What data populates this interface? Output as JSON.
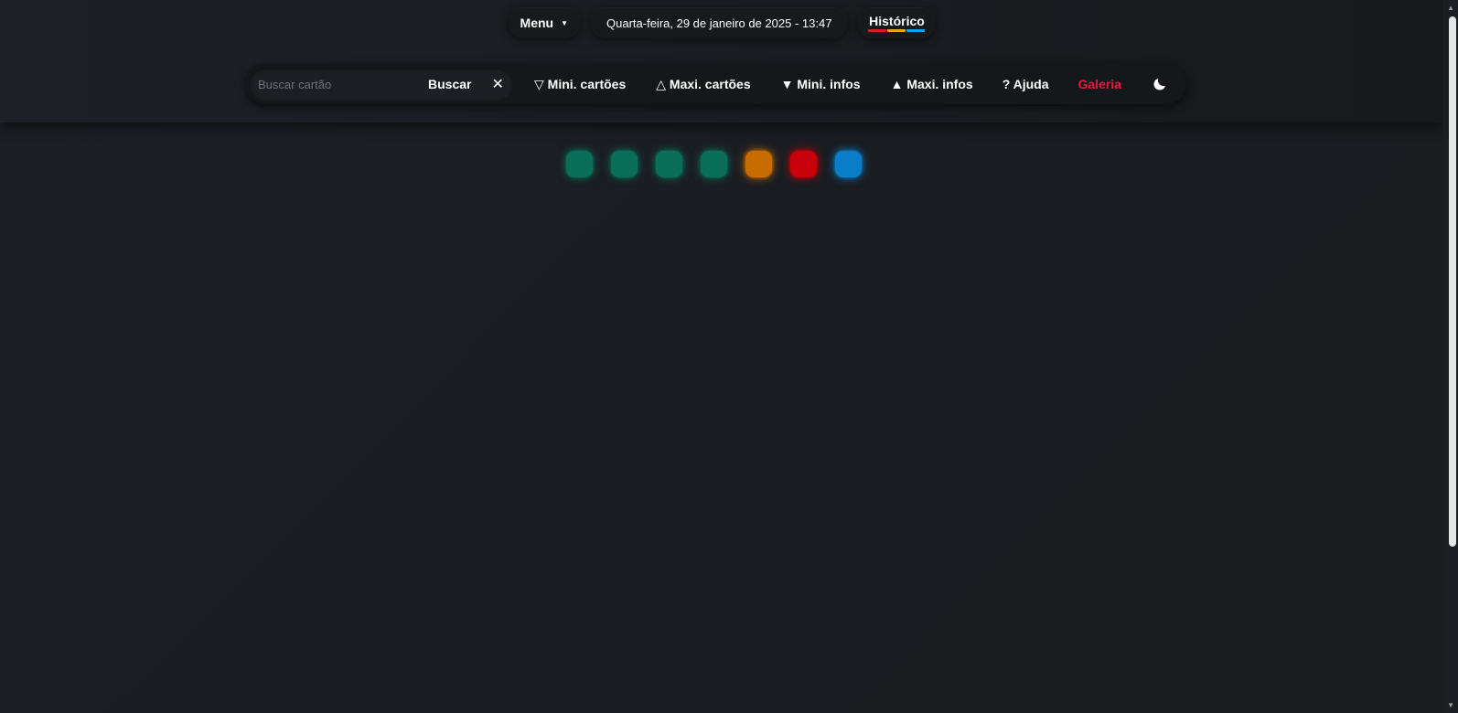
{
  "topbar": {
    "menu_label": "Menu",
    "date_text": "Quarta-feira, 29 de janeiro de 2025 - 13:47",
    "history_label": "Histórico",
    "history_colors": [
      "#e01a22",
      "#f0a020",
      "#1aa0e0"
    ]
  },
  "toolbar": {
    "search_placeholder": "Buscar cartão",
    "search_value": "",
    "search_button": "Buscar",
    "clear_symbol": "✕",
    "items": [
      {
        "label": "▽ Mini. cartões"
      },
      {
        "label": "△ Maxi. cartões"
      },
      {
        "label": "▼ Mini. infos"
      },
      {
        "label": "▲ Maxi. infos"
      },
      {
        "label": "? Ajuda"
      },
      {
        "label": "Galeria",
        "color": "#e8153e"
      }
    ],
    "theme_icon": "moon-icon"
  },
  "status_dots": [
    {
      "color": "#0b6e58"
    },
    {
      "color": "#0b6e58"
    },
    {
      "color": "#0b6e58"
    },
    {
      "color": "#0b6e58"
    },
    {
      "color": "#c86c00"
    },
    {
      "color": "#c8000a"
    },
    {
      "color": "#0a7ec8"
    }
  ]
}
